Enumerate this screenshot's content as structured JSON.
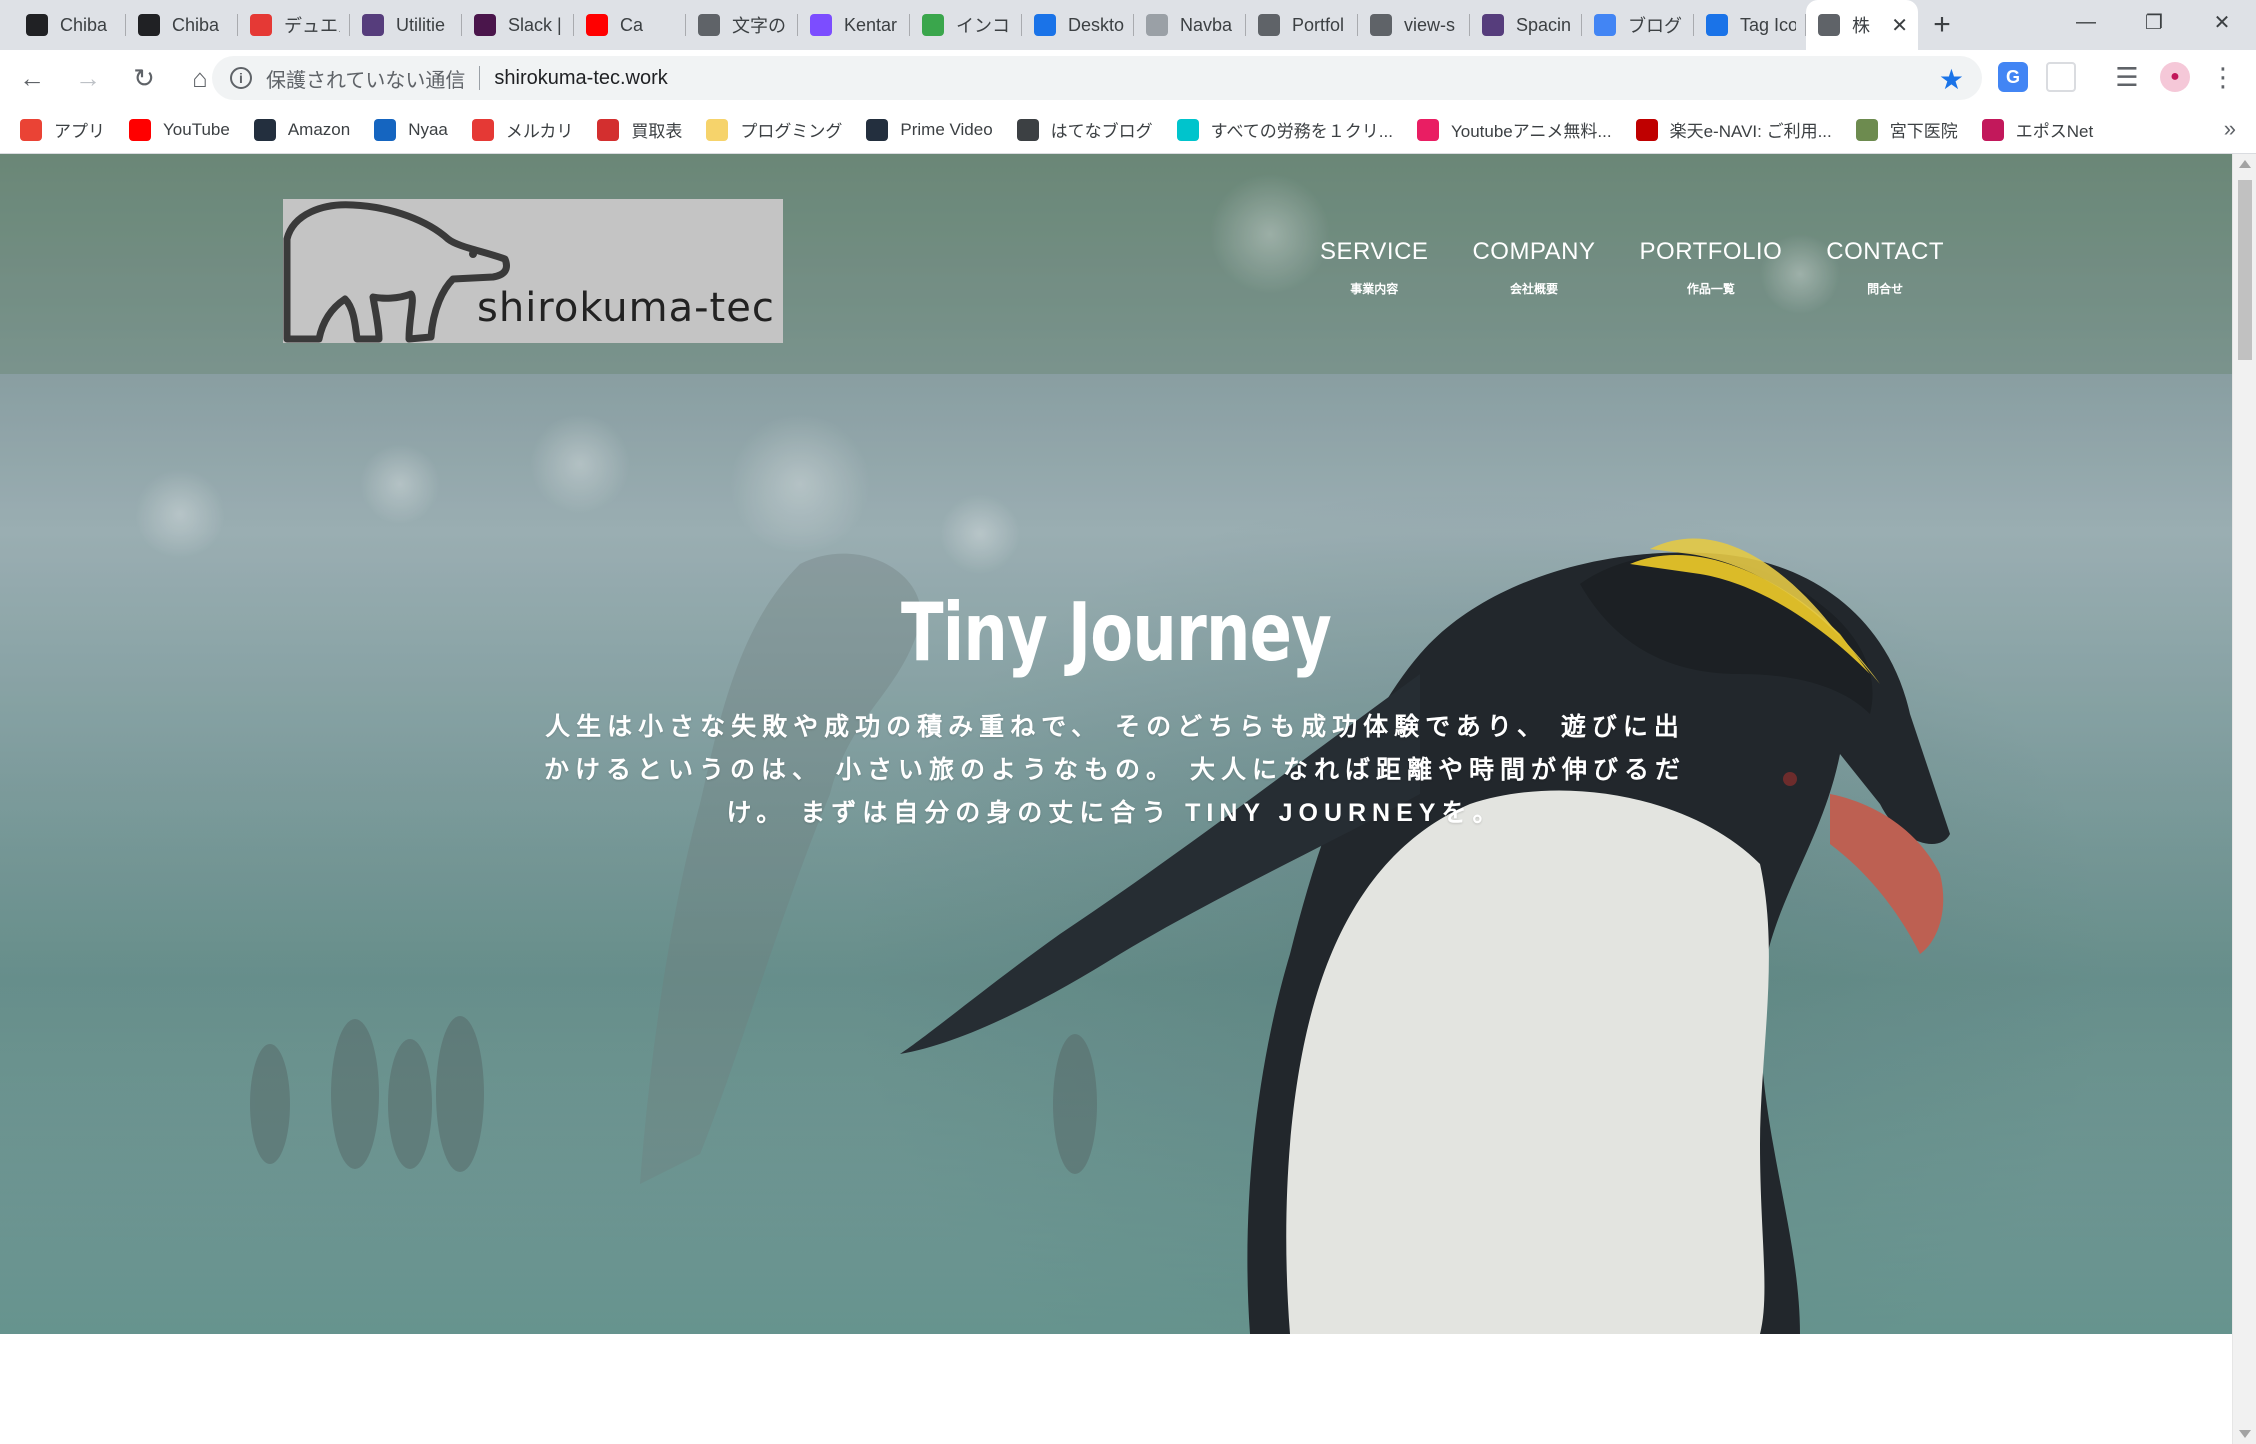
{
  "browser": {
    "tabs": [
      {
        "label": "Chiba",
        "icon": "bird-favicon",
        "color": "#202124"
      },
      {
        "label": "Chiba",
        "icon": "bird-favicon",
        "color": "#202124"
      },
      {
        "label": "デュエル",
        "icon": "app-favicon",
        "color": "#e53935"
      },
      {
        "label": "Utilitie",
        "icon": "bootstrap-favicon",
        "color": "#563d7c"
      },
      {
        "label": "Slack |",
        "icon": "slack-favicon",
        "color": "#4a154b"
      },
      {
        "label": "Ca",
        "icon": "youtube-favicon",
        "color": "#ff0000"
      },
      {
        "label": "文字の",
        "icon": "globe-favicon",
        "color": "#5f6368"
      },
      {
        "label": "Kentar",
        "icon": "k-favicon",
        "color": "#7c4dff"
      },
      {
        "label": "インコ",
        "icon": "pixiv-favicon",
        "color": "#3aa64c"
      },
      {
        "label": "Deskto",
        "icon": "flag-favicon",
        "color": "#1a73e8"
      },
      {
        "label": "Navba",
        "icon": "doc-favicon",
        "color": "#9aa0a6"
      },
      {
        "label": "Portfol",
        "icon": "globe-favicon",
        "color": "#5f6368"
      },
      {
        "label": "view-s",
        "icon": "globe-favicon",
        "color": "#5f6368"
      },
      {
        "label": "Spacin",
        "icon": "bootstrap-favicon",
        "color": "#563d7c"
      },
      {
        "label": "ブログラ",
        "icon": "google-favicon",
        "color": "#4285f4"
      },
      {
        "label": "Tag Ico",
        "icon": "flag-favicon",
        "color": "#1a73e8"
      },
      {
        "label": "株",
        "icon": "bear-favicon",
        "color": "#5f6368"
      }
    ],
    "new_tab": "+",
    "window": {
      "minimize": "—",
      "maximize": "❐",
      "close": "✕"
    },
    "toolbar": {
      "back": "←",
      "forward": "→",
      "reload": "↻",
      "home": "⌂",
      "security_label": "保護されていない通信",
      "url": "shirokuma-tec.work"
    },
    "bookmarks": [
      {
        "label": "アプリ",
        "icon": "apps-grid-icon",
        "color": "#ea4335"
      },
      {
        "label": "YouTube",
        "icon": "youtube-icon",
        "color": "#ff0000"
      },
      {
        "label": "Amazon",
        "icon": "amazon-icon",
        "color": "#232f3e"
      },
      {
        "label": "Nyaa",
        "icon": "nyaa-icon",
        "color": "#1565c0"
      },
      {
        "label": "メルカリ",
        "icon": "mercari-icon",
        "color": "#e53935"
      },
      {
        "label": "買取表",
        "icon": "kaitori-icon",
        "color": "#d32f2f"
      },
      {
        "label": "プログミング",
        "icon": "folder-icon",
        "color": "#f6d36b"
      },
      {
        "label": "Prime Video",
        "icon": "amazon-icon",
        "color": "#232f3e"
      },
      {
        "label": "はてなブログ",
        "icon": "hatena-icon",
        "color": "#3c4043"
      },
      {
        "label": "すべての労務を１クリ...",
        "icon": "smarthr-icon",
        "color": "#00c4cc"
      },
      {
        "label": "Youtubeアニメ無料...",
        "icon": "anime-icon",
        "color": "#e91e63"
      },
      {
        "label": "楽天e-NAVI: ご利用...",
        "icon": "rakuten-icon",
        "color": "#bf0000"
      },
      {
        "label": "宮下医院",
        "icon": "clinic-icon",
        "color": "#6d8b4f"
      },
      {
        "label": "エポスNet",
        "icon": "epos-icon",
        "color": "#c2185b"
      }
    ],
    "bookmarks_more": "»"
  },
  "page": {
    "logo_text": "shirokuma-tec",
    "nav": [
      {
        "en": "SERVICE",
        "ja": "事業内容"
      },
      {
        "en": "COMPANY",
        "ja": "会社概要"
      },
      {
        "en": "PORTFOLIO",
        "ja": "作品一覧"
      },
      {
        "en": "CONTACT",
        "ja": "問合せ"
      }
    ],
    "hero_title": "Tiny Journey",
    "hero_copy": "人生は小さな失敗や成功の積み重ねで、 そのどちらも成功体験であり、 遊びに出かけるというのは、 小さい旅のようなもの。 大人になれば距離や時間が伸びるだけ。 まずは自分の身の丈に合う TINY JOURNEYを。"
  }
}
